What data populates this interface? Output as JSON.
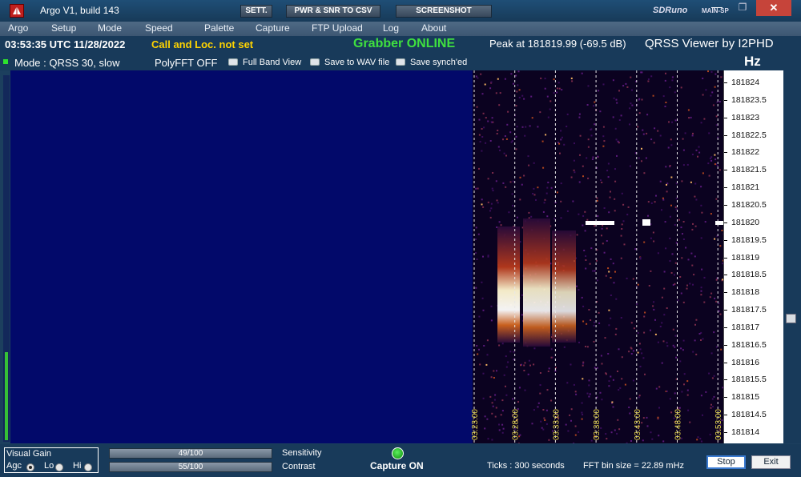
{
  "window": {
    "title": "Argo V1, build 143",
    "sett_label": "SETT.",
    "pwr_label": "PWR & SNR TO CSV",
    "screenshot_label": "SCREENSHOT",
    "sdr_label": "SDRuno",
    "main_label": "MAIN-SP",
    "minimize_icon": "minimize-icon",
    "maximize_icon": "maximize-icon",
    "close_icon": "close-icon",
    "close_glyph": "✕",
    "minimize_glyph": "—",
    "maximize_glyph": "❐"
  },
  "menu": [
    "Argo",
    "Setup",
    "Mode",
    "Speed",
    "Palette",
    "Capture",
    "FTP Upload",
    "Log",
    "About"
  ],
  "status": {
    "time": "03:53:35 UTC  11/28/2022",
    "call": "Call and Loc. not set",
    "grabber": "Grabber ONLINE",
    "peak": "Peak at  181819.99 (-69.5 dB)",
    "viewer": "QRSS Viewer by I2PHD"
  },
  "options": {
    "mode": "Mode : QRSS 30, slow",
    "polyfft": "PolyFFT OFF",
    "full_band": "Full Band View",
    "save_wav": "Save to WAV file",
    "save_synched": "Save synch'ed",
    "hz": "Hz"
  },
  "frequency_scale": [
    "181824",
    "181823.5",
    "181823",
    "181822.5",
    "181822",
    "181821.5",
    "181821",
    "181820.5",
    "181820",
    "181819.5",
    "181819",
    "181818.5",
    "181818",
    "181817.5",
    "181817",
    "181816.5",
    "181816",
    "181815.5",
    "181815",
    "181814.5",
    "181814"
  ],
  "time_marks": [
    "03:23:00",
    "03:28:00",
    "03:33:00",
    "03:38:00",
    "03:43:00",
    "03:48:00",
    "03:53:00"
  ],
  "colors": {
    "waterfall_bg": "#02096a",
    "time_label": "#e8d84a",
    "grabber": "#3fe03f",
    "call": "#ffd400"
  },
  "bottom": {
    "visual_gain": "Visual Gain",
    "agc": "Agc",
    "lo": "Lo",
    "hi": "Hi",
    "sensitivity_value": "49/100",
    "sensitivity_label": "Sensitivity",
    "contrast_value": "55/100",
    "contrast_label": "Contrast",
    "capture": "Capture ON",
    "ticks": "Ticks  : 300 seconds",
    "fft_bin": "FFT bin size = 22.89 mHz",
    "stop": "Stop",
    "exit": "Exit"
  }
}
